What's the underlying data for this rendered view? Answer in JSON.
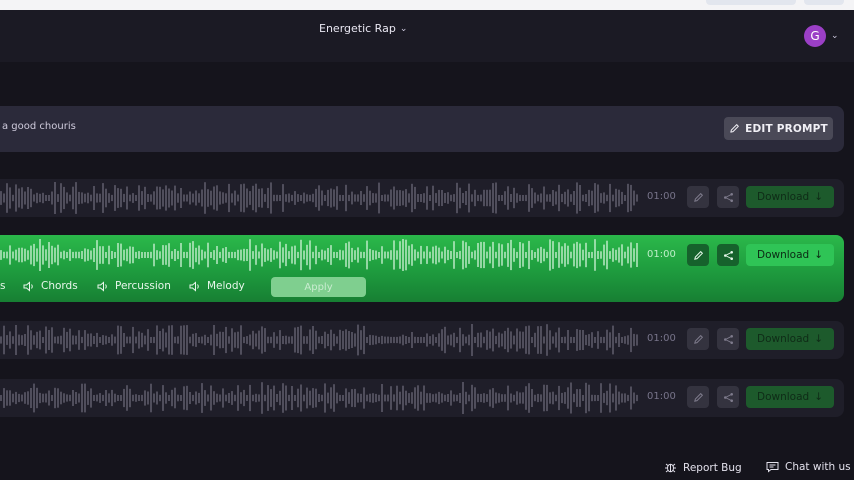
{
  "header": {
    "title": "Energetic Rap",
    "avatar_initial": "G"
  },
  "prompt": {
    "text": "a good chouris",
    "edit_label": "EDIT PROMPT"
  },
  "tracks": [
    {
      "time": "01:00",
      "download_label": "Download",
      "active": false
    },
    {
      "time": "01:00",
      "download_label": "Download",
      "active": true
    },
    {
      "time": "01:00",
      "download_label": "Download",
      "active": false
    },
    {
      "time": "01:00",
      "download_label": "Download",
      "active": false
    }
  ],
  "stems": {
    "items": [
      "Chords",
      "Percussion",
      "Melody"
    ],
    "apply_label": "Apply"
  },
  "footer": {
    "report_bug": "Report Bug",
    "chat": "Chat with us"
  },
  "colors": {
    "accent_green": "#2bb84a",
    "avatar": "#9b3fc6",
    "background": "#15141c"
  },
  "icons": [
    "chevron-down-icon",
    "pencil-icon",
    "share-icon",
    "download-arrow-icon",
    "speaker-icon",
    "bug-icon",
    "chat-icon"
  ]
}
